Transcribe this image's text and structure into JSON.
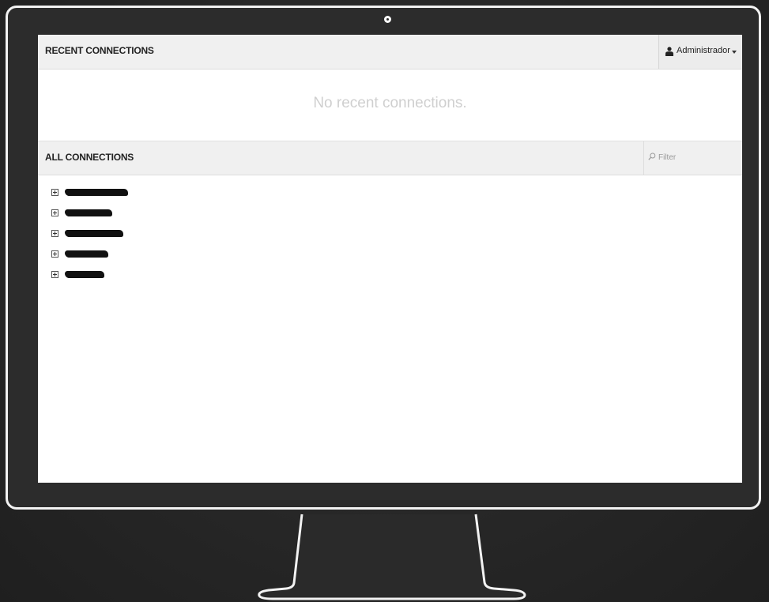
{
  "recent": {
    "title": "RECENT CONNECTIONS",
    "empty_message": "No recent connections."
  },
  "user_menu": {
    "username": "Administrador"
  },
  "all": {
    "title": "ALL CONNECTIONS",
    "filter_placeholder": "Filter"
  },
  "connections": [
    {
      "name": "",
      "redacted": true
    },
    {
      "name": "",
      "redacted": true
    },
    {
      "name": "",
      "redacted": true
    },
    {
      "name": "",
      "redacted": true
    },
    {
      "name": "",
      "redacted": true
    }
  ],
  "icons": {
    "user": "user-icon",
    "caret": "chevron-down-icon",
    "filter": "search-icon",
    "expand": "plus-square-icon"
  },
  "colors": {
    "header_bg": "#f0f0f0",
    "empty_text": "#cfcfcf",
    "bezel": "#f2f2f2",
    "background": "#2b2b2b"
  }
}
